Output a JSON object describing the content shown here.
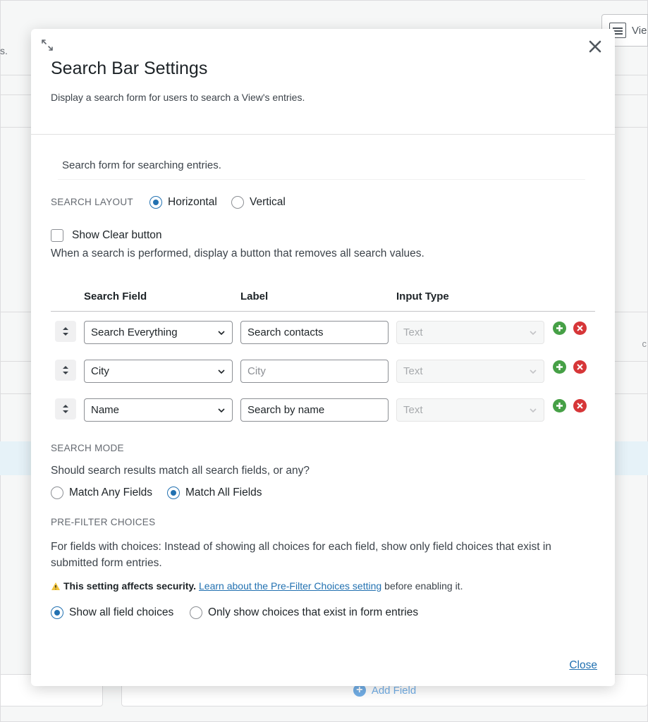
{
  "background": {
    "view_button_label": "Vie",
    "left_text": "s.",
    "right_text": "c",
    "add_field_label": "Add Field"
  },
  "modal": {
    "title": "Search Bar Settings",
    "description": "Display a search form for users to search a View's entries.",
    "close_icon": "close-icon",
    "intro": "Search form for searching entries.",
    "search_layout": {
      "label": "SEARCH LAYOUT",
      "options": [
        {
          "label": "Horizontal",
          "selected": true
        },
        {
          "label": "Vertical",
          "selected": false
        }
      ]
    },
    "show_clear": {
      "label": "Show Clear button",
      "checked": false,
      "help": "When a search is performed, display a button that removes all search values."
    },
    "fields_table": {
      "headers": [
        "Search Field",
        "Label",
        "Input Type"
      ],
      "rows": [
        {
          "field": "Search Everything",
          "label": "Search contacts",
          "label_is_placeholder": false,
          "input_type": "Text"
        },
        {
          "field": "City",
          "label": "City",
          "label_is_placeholder": true,
          "input_type": "Text"
        },
        {
          "field": "Name",
          "label": "Search by name",
          "label_is_placeholder": false,
          "input_type": "Text"
        }
      ]
    },
    "search_mode": {
      "label": "SEARCH MODE",
      "question": "Should search results match all search fields, or any?",
      "options": [
        {
          "label": "Match Any Fields",
          "selected": false
        },
        {
          "label": "Match All Fields",
          "selected": true
        }
      ]
    },
    "prefilter": {
      "label": "PRE-FILTER CHOICES",
      "description": "For fields with choices: Instead of showing all choices for each field, show only field choices that exist in submitted form entries.",
      "warning_bold": "This setting affects security.",
      "warning_link": "Learn about the Pre-Filter Choices setting",
      "warning_tail": "before enabling it.",
      "options": [
        {
          "label": "Show all field choices",
          "selected": true
        },
        {
          "label": "Only show choices that exist in form entries",
          "selected": false
        }
      ]
    },
    "close_link": "Close"
  },
  "colors": {
    "accent": "#2271b1",
    "add": "#46a046",
    "remove": "#d63638"
  }
}
